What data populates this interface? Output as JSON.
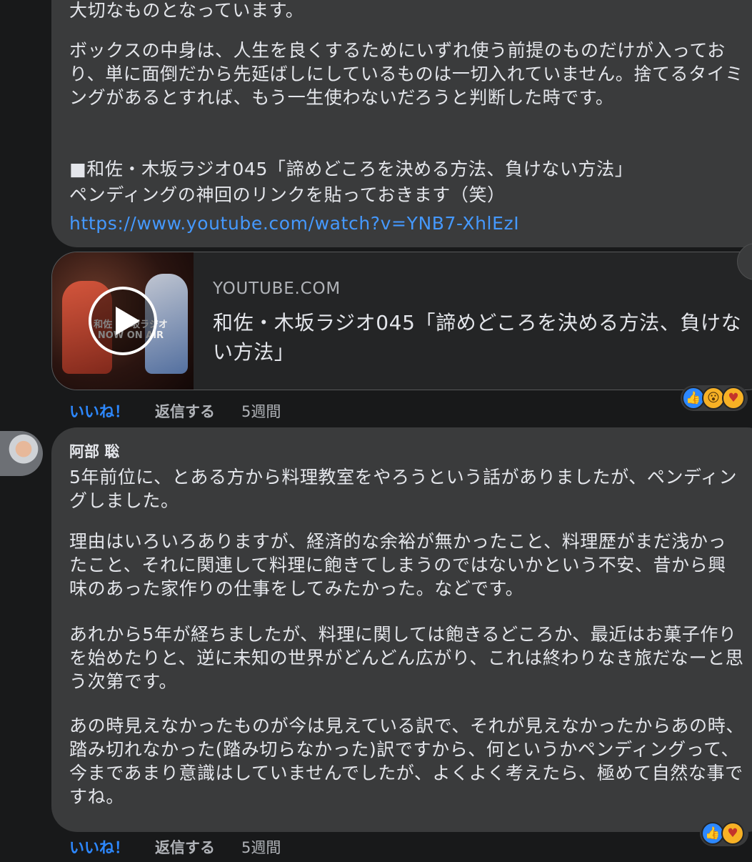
{
  "comment1": {
    "paragraphs": [
      "大切なものとなっています。",
      "ボックスの中身は、人生を良くするためにいずれ使う前提のものだけが入っており、単に面倒だから先延ばしにしているものは一切入れていません。捨てるタイミングがあるとすれば、もう一生使わないだろうと判断した時です。",
      "■和佐・木坂ラジオ045「諦めどころを決める方法、負けない方法」",
      "ペンディングの神回のリンクを貼っておきます（笑）"
    ],
    "link": "https://www.youtube.com/watch?v=YNB7-XhlEzI",
    "preview": {
      "domain": "YOUTUBE.COM",
      "title": "和佐・木坂ラジオ045「諦めどころを決める方法、負けない方法」",
      "thumb_text": "和佐・木坂ラジオ NOW ON AIR"
    },
    "actions": {
      "like": "いいね！",
      "reply": "返信する",
      "time": "5週間"
    },
    "reactions": [
      "like-icon",
      "wow-icon",
      "care-icon"
    ]
  },
  "comment2": {
    "author": "阿部 聡",
    "paragraphs": [
      "5年前位に、とある方から料理教室をやろうという話がありましたが、ペンディングしました。",
      "理由はいろいろありますが、経済的な余裕が無かったこと、料理歴がまだ浅かったこと、それに関連して料理に飽きてしまうのではないかという不安、昔から興味のあった家作りの仕事をしてみたかった。などです。",
      "あれから5年が経ちましたが、料理に関しては飽きるどころか、最近はお菓子作りを始めたりと、逆に未知の世界がどんどん広がり、これは終わりなき旅だなーと思う次第です。",
      "あの時見えなかったものが今は見えている訳で、それが見えなかったからあの時、踏み切れなかった(踏み切らなかった)訳ですから、何というかペンディングって、今まであまり意識はしていませんでしたが、よくよく考えたら、極めて自然な事ですね。"
    ],
    "actions": {
      "like": "いいね！",
      "reply": "返信する",
      "time": "5週間"
    },
    "reactions": [
      "like-icon",
      "care-icon"
    ]
  },
  "colors": {
    "background": "#18191a",
    "bubble": "#3a3b3c",
    "link": "#4599ff",
    "accent": "#2d88ff"
  }
}
